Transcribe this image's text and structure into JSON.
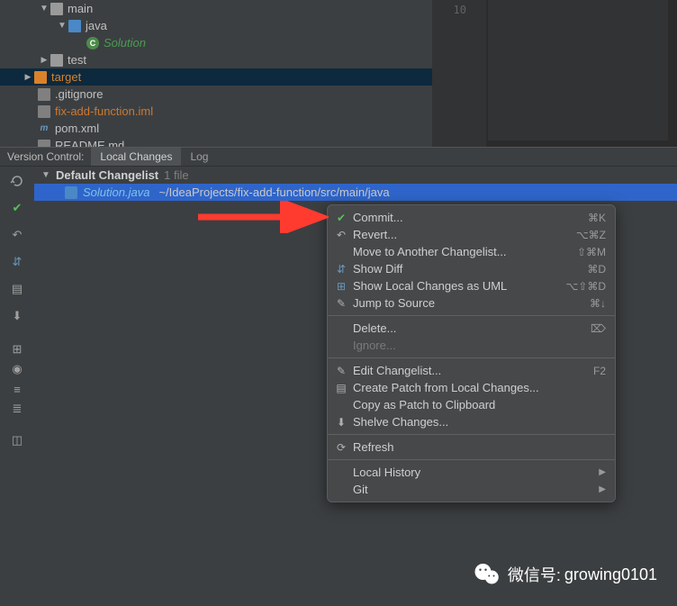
{
  "tree": {
    "main": "main",
    "java": "java",
    "solution": "Solution",
    "test": "test",
    "target": "target",
    "gitignore": ".gitignore",
    "iml": "fix-add-function.iml",
    "pom": "pom.xml",
    "readme": "README.md"
  },
  "gutter": {
    "line": "10"
  },
  "vc": {
    "title": "Version Control:",
    "tab_local": "Local Changes",
    "tab_log": "Log"
  },
  "changelist": {
    "name": "Default Changelist",
    "count": "1 file",
    "file": "Solution.java",
    "path": "~/IdeaProjects/fix-add-function/src/main/java"
  },
  "menu": {
    "commit": "Commit...",
    "commit_sc": "⌘K",
    "revert": "Revert...",
    "revert_sc": "⌥⌘Z",
    "move": "Move to Another Changelist...",
    "move_sc": "⇧⌘M",
    "diff": "Show Diff",
    "diff_sc": "⌘D",
    "uml": "Show Local Changes as UML",
    "uml_sc": "⌥⇧⌘D",
    "jump": "Jump to Source",
    "jump_sc": "⌘↓",
    "delete": "Delete...",
    "delete_sc": "⌦",
    "ignore": "Ignore...",
    "edit": "Edit Changelist...",
    "edit_sc": "F2",
    "patch": "Create Patch from Local Changes...",
    "copy_patch": "Copy as Patch to Clipboard",
    "shelve": "Shelve Changes...",
    "refresh": "Refresh",
    "history": "Local History",
    "git": "Git"
  },
  "watermark": {
    "label": "微信号:",
    "id": "growing0101"
  }
}
